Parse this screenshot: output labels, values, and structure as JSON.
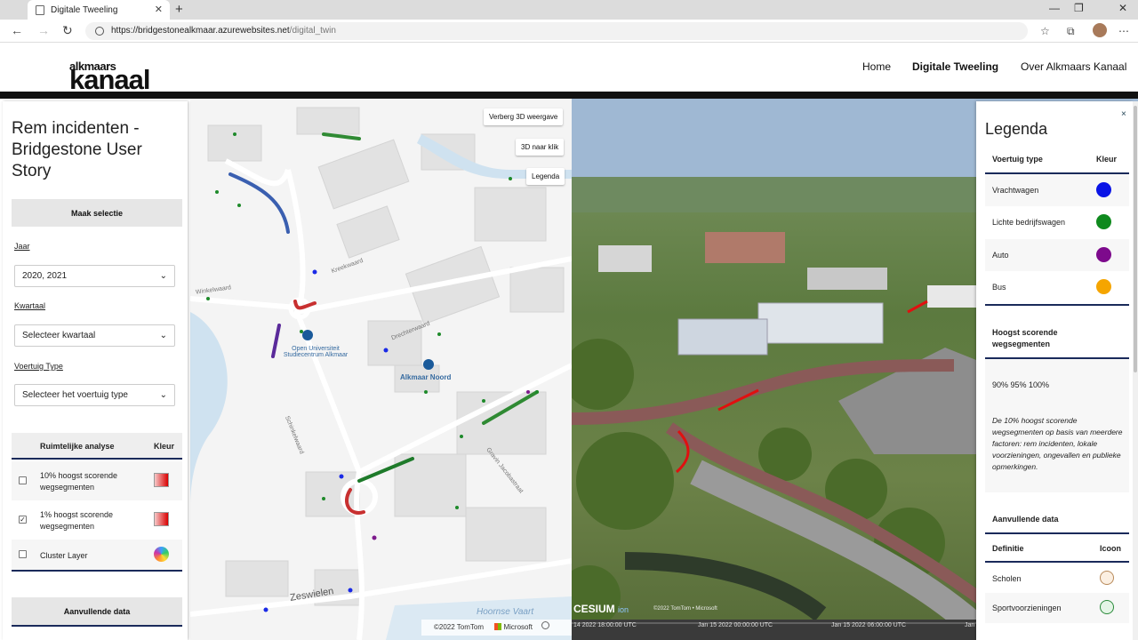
{
  "browser": {
    "tab_title": "Digitale Tweeling",
    "url_host": "https://bridgestonealkmaar.azurewebsites.net",
    "url_path": "/digital_twin"
  },
  "site": {
    "logo_top": "alkmaars",
    "logo_bottom": "kanaal",
    "nav": [
      "Home",
      "Digitale Tweeling",
      "Over Alkmaars Kanaal"
    ]
  },
  "panel": {
    "title": "Rem incidenten - Bridgestone User Story",
    "select_button": "Maak selectie",
    "year_label": "Jaar",
    "year_value": "2020, 2021",
    "quarter_label": "Kwartaal",
    "quarter_value": "Selecteer kwartaal",
    "vehicle_label": "Voertuig Type",
    "vehicle_value": "Selecteer het voertuig type",
    "analysis_header": "Ruimtelijke analyse",
    "color_header": "Kleur",
    "layers": [
      {
        "label": "10% hoogst scorende wegsegmenten",
        "checked": false
      },
      {
        "label": "1% hoogst scorende wegsegmenten",
        "checked": true
      },
      {
        "label": "Cluster Layer",
        "checked": false
      }
    ],
    "extra_button": "Aanvullende data"
  },
  "map": {
    "buttons": [
      "Verberg 3D weergave",
      "3D naar klik",
      "Legenda"
    ],
    "labels": {
      "ou": "Open Universiteit Studiecentrum Alkmaar",
      "station": "Alkmaar Noord",
      "zeswielen": "Zeswielen",
      "hoornse": "Hoornse Vaart",
      "drechterwaard": "Drechterwaard",
      "kreekwaard": "Kreekwaard",
      "schinkelwaard": "Schinkelwaard",
      "winkelwaard": "Winkelwaard",
      "gravin": "Gravin Jacobastraat"
    },
    "attrib_tomtom": "©2022 TomTom",
    "attrib_microsoft": "Microsoft",
    "cesium_credit": "©2022 TomTom • Microsoft",
    "cesium_logo": "CESIUM",
    "cesium_ion": "ion",
    "timeline": [
      "14 2022 18:00:00 UTC",
      "Jan 15 2022 00:00:00 UTC",
      "Jan 15 2022 06:00:00 UTC",
      "Jan"
    ]
  },
  "legend": {
    "title": "Legenda",
    "close": "×",
    "vehicle_header": "Voertuig type",
    "color_header": "Kleur",
    "vehicles": [
      {
        "label": "Vrachtwagen",
        "color": "#0a14e6"
      },
      {
        "label": "Lichte bedrijfswagen",
        "color": "#0f8a1e"
      },
      {
        "label": "Auto",
        "color": "#7d0a8c"
      },
      {
        "label": "Bus",
        "color": "#f5a500"
      }
    ],
    "segments_header": "Hoogst scorende wegsegmenten",
    "percentiles": "90% 95% 100%",
    "description": "De 10% hoogst scorende wegsegmenten op basis van meerdere factoren: rem incidenten, lokale voorzieningen, ongevallen en publieke opmerkingen.",
    "extra_header": "Aanvullende data",
    "def_header": "Definitie",
    "icon_header": "Icoon",
    "extras": [
      "Scholen",
      "Sportvoorzieningen"
    ]
  }
}
